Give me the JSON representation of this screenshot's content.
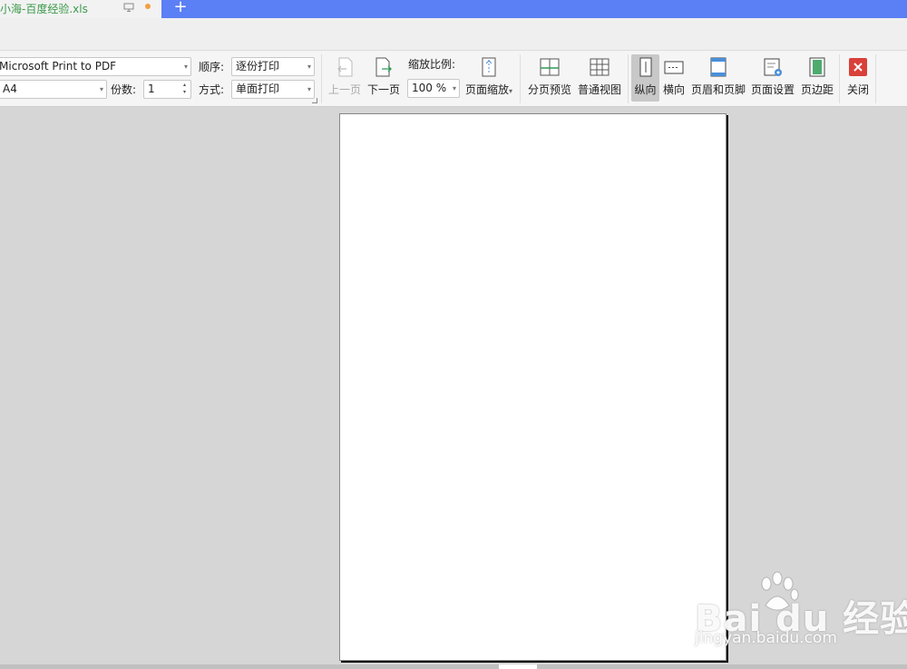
{
  "tab": {
    "title": "小海-百度经验.xls",
    "add_label": "+"
  },
  "printer": {
    "name": "Microsoft Print to PDF",
    "paper": "A4",
    "order_label": "顺序:",
    "order_value": "逐份打印",
    "copies_label": "份数:",
    "copies_value": "1",
    "mode_label": "方式:",
    "mode_value": "单面打印"
  },
  "nav": {
    "prev_label": "上一页",
    "next_label": "下一页"
  },
  "zoom": {
    "label": "缩放比例:",
    "value": "100 %",
    "fit_label": "页面缩放"
  },
  "view": {
    "page_break_label": "分页预览",
    "normal_label": "普通视图"
  },
  "orientation": {
    "portrait_label": "纵向",
    "landscape_label": "横向",
    "selected": "portrait"
  },
  "layout": {
    "header_footer_label": "页眉和页脚",
    "page_setup_label": "页面设置",
    "margins_label": "页边距",
    "close_label": "关闭"
  },
  "watermark": {
    "brand": "Bai du 经验",
    "url": "jingyan.baidu.com"
  },
  "colors": {
    "tab_strip": "#5b7ff5",
    "tab_title": "#3a9a4a",
    "close_icon": "#d9403a",
    "icon_green": "#2e9c55"
  }
}
